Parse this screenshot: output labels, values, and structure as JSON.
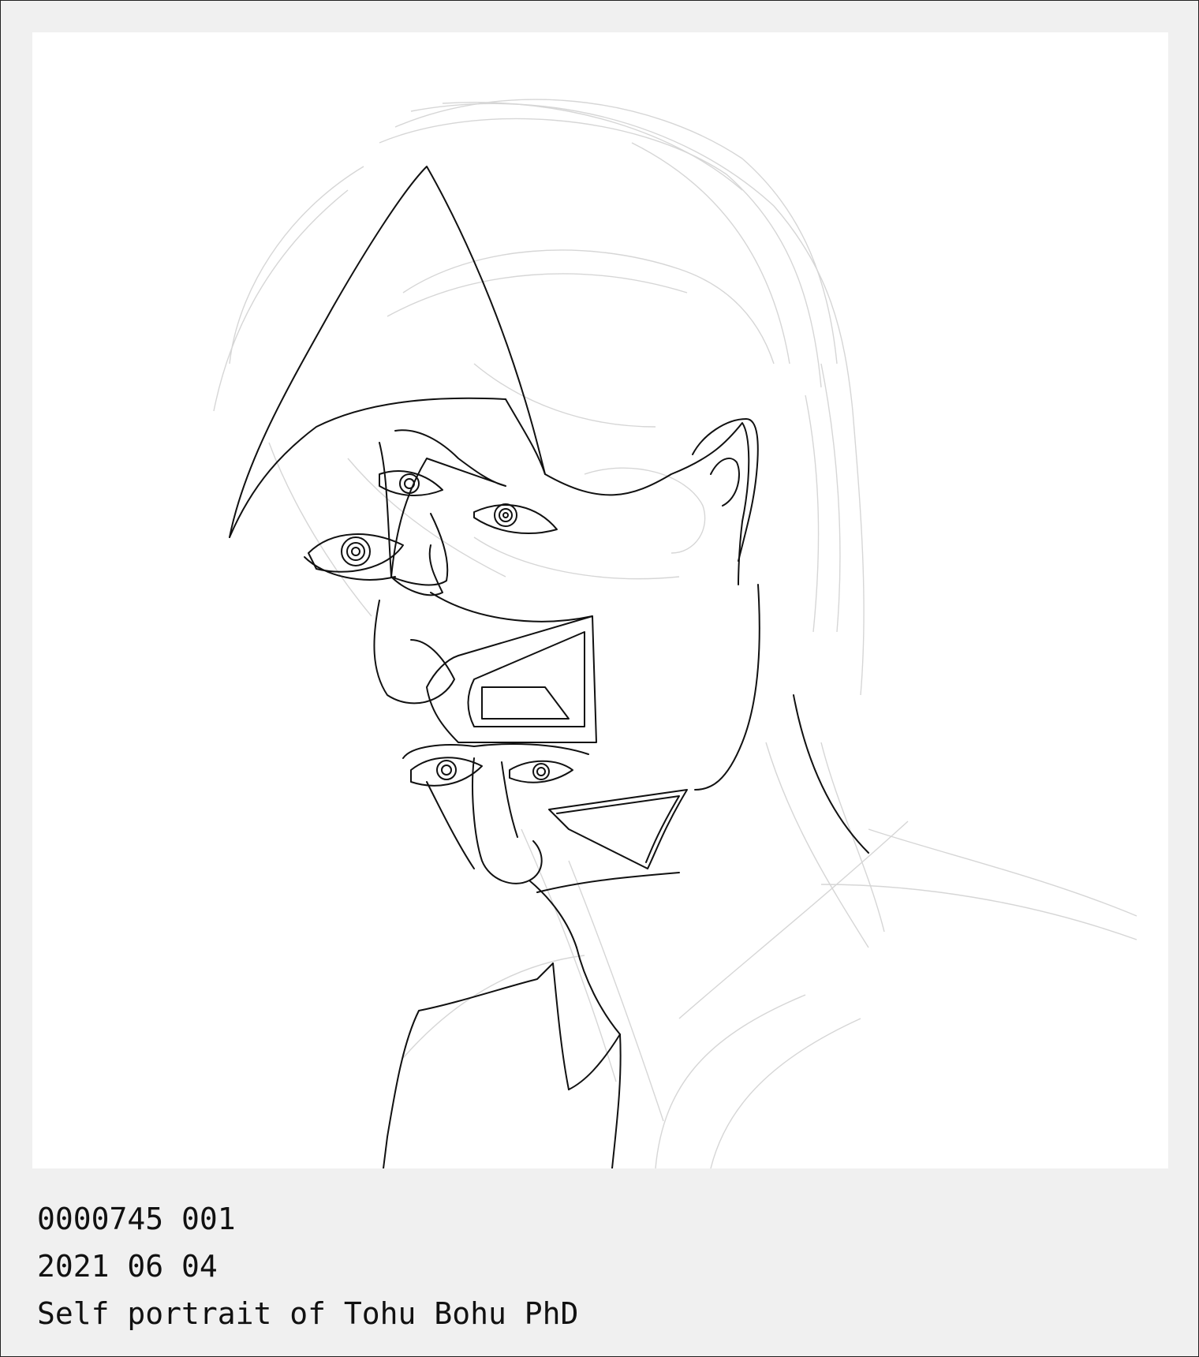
{
  "artwork": {
    "subject": "self-portrait-line-drawing"
  },
  "caption": {
    "catalog_number": "0000745 001",
    "date": "2021 06 04",
    "title": "Self portrait of Tohu Bohu PhD"
  }
}
